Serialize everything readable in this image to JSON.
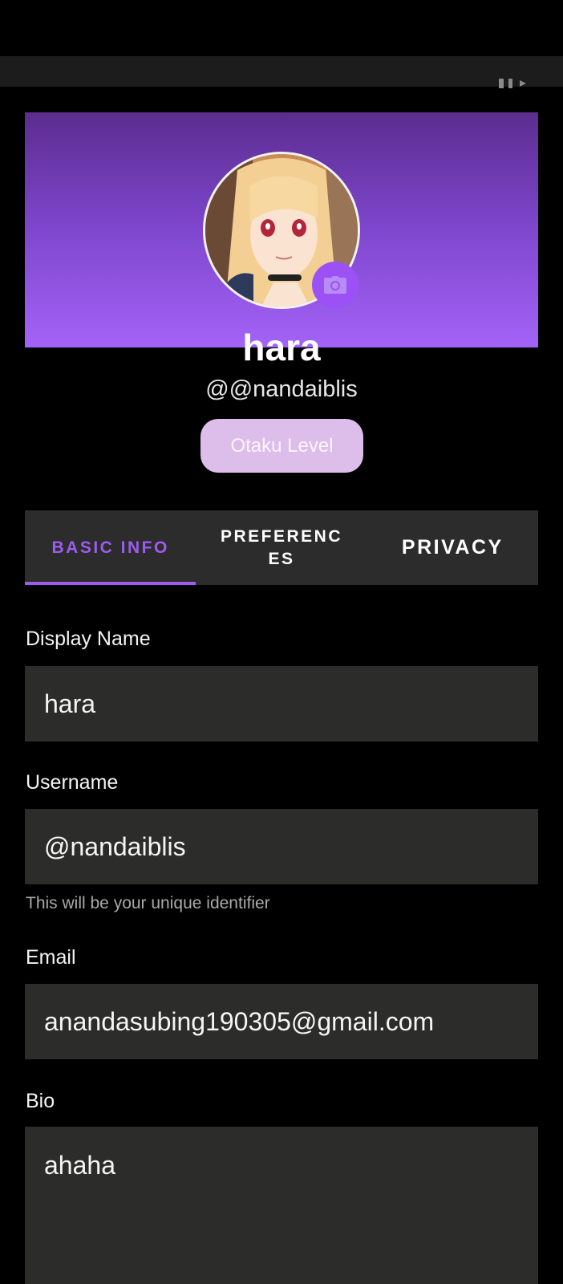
{
  "profile": {
    "name": "hara",
    "handle": "@@nandaiblis",
    "level_button": "Otaku Level"
  },
  "tabs": [
    {
      "label": "BASIC INFO",
      "active": true
    },
    {
      "label": "PREFERENCES",
      "active": false
    },
    {
      "label": "PRIVACY",
      "active": false
    }
  ],
  "form": {
    "display_name": {
      "label": "Display Name",
      "value": "hara"
    },
    "username": {
      "label": "Username",
      "value": "@nandaiblis",
      "helper": "This will be your unique identifier"
    },
    "email": {
      "label": "Email",
      "value": "anandasubing190305@gmail.com"
    },
    "bio": {
      "label": "Bio",
      "value": "ahaha"
    }
  },
  "icons": {
    "camera": "camera-icon",
    "exit": "exit-icon"
  },
  "colors": {
    "accent": "#9c5cf0",
    "cover_top": "#5b2d8e",
    "cover_bottom": "#a463f8",
    "badge": "#ddbde9",
    "field_bg": "#2c2d2b"
  }
}
